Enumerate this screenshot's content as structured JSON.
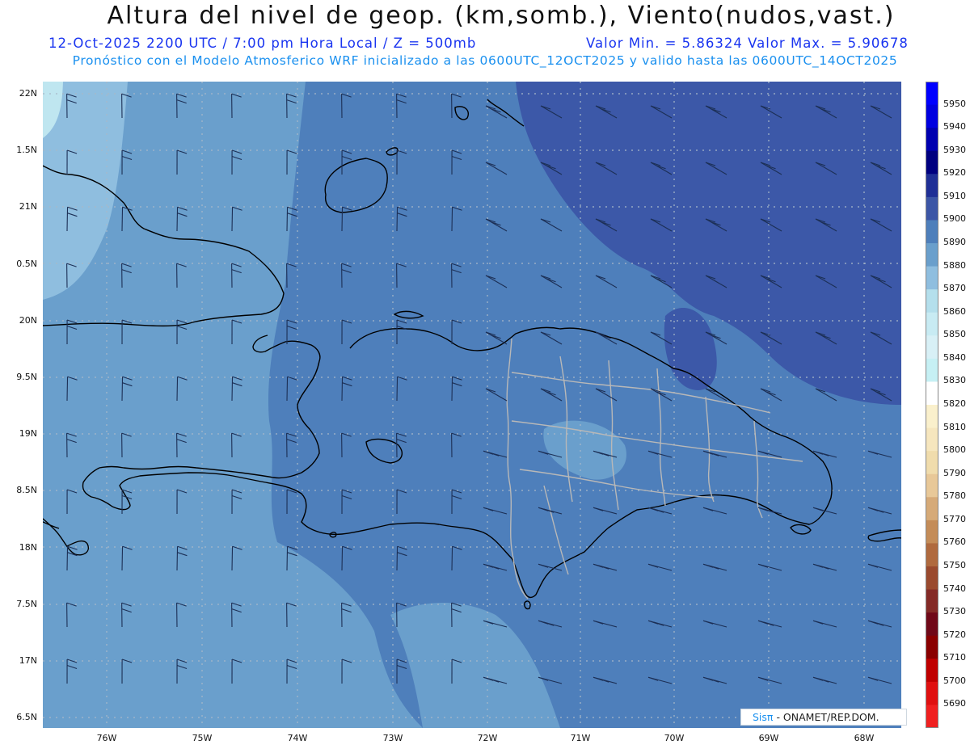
{
  "title": "Altura del nivel de geop. (km,somb.), Viento(nudos,vast.)",
  "subtitle": {
    "left": "12-Oct-2025  2200 UTC / 7:00 pm Hora Local / Z = 500mb",
    "right": "Valor Min. = 5.86324  Valor Max. = 5.90678"
  },
  "subtitle2": "Pronóstico con el Modelo Atmosferico WRF inicializado a las 0600UTC_12OCT2025 y valido hasta las  0600UTC_14OCT2025",
  "map": {
    "lat_labels": [
      "22N",
      "1.5N",
      "21N",
      "0.5N",
      "20N",
      "9.5N",
      "19N",
      "8.5N",
      "18N",
      "7.5N",
      "17N",
      "6.5N"
    ],
    "lon_labels": [
      "76W",
      "75W",
      "74W",
      "73W",
      "72W",
      "71W",
      "70W",
      "69W",
      "68W"
    ],
    "colors": {
      "band_5870": "#8fbedf",
      "band_5880": "#6a9fcc",
      "band_5890": "#4e7fbb",
      "band_5900": "#3c58a8",
      "band_5860": "#bfe6f0",
      "coast": "#000000",
      "provinces": "#b8b8b8",
      "grid": "#a8b8c8",
      "barb": "#1c2f55"
    }
  },
  "colorbar": {
    "labels": [
      "5950",
      "5940",
      "5930",
      "5920",
      "5910",
      "5900",
      "5890",
      "5880",
      "5870",
      "5860",
      "5850",
      "5840",
      "5830",
      "5820",
      "5810",
      "5800",
      "5790",
      "5780",
      "5770",
      "5760",
      "5750",
      "5740",
      "5730",
      "5720",
      "5710",
      "5700",
      "5690"
    ],
    "colors": [
      "#0000ff",
      "#0000e0",
      "#0000b0",
      "#000080",
      "#1f2f96",
      "#3c56a6",
      "#4e7fbb",
      "#6a9fcc",
      "#8fbedf",
      "#b4dfec",
      "#c8ebf3",
      "#d8f0f6",
      "#c6f0f4",
      "#ffffff",
      "#faf0cc",
      "#f6e6be",
      "#f0dcac",
      "#e8c898",
      "#d6aa78",
      "#c48c58",
      "#b06a3e",
      "#9a4a2e",
      "#842a26",
      "#700818",
      "#8a0000",
      "#c00000",
      "#e01010",
      "#f02020"
    ]
  },
  "credit": {
    "brand": "Sisπ",
    "text": "- ONAMET/REP.DOM."
  }
}
